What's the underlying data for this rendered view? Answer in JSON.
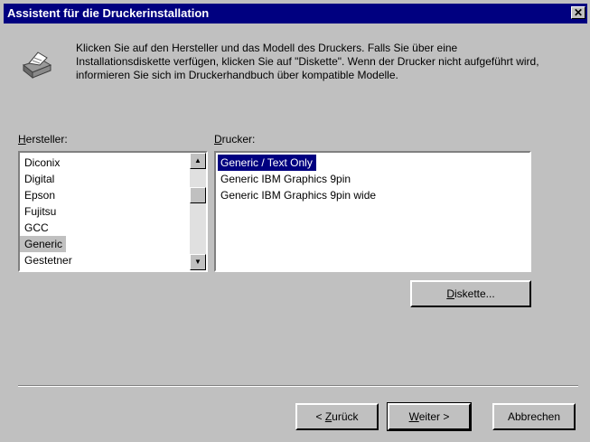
{
  "window": {
    "title": "Assistent für die Druckerinstallation",
    "close_glyph": "✕"
  },
  "intro": {
    "text": "Klicken Sie auf den Hersteller und das Modell des Druckers. Falls Sie über eine Installationsdiskette verfügen, klicken Sie auf \"Diskette\". Wenn der Drucker nicht aufgeführt wird, informieren Sie sich im Druckerhandbuch über kompatible Modelle."
  },
  "manufacturer": {
    "label_hotkey": "H",
    "label_rest": "ersteller:",
    "items": [
      "Diconix",
      "Digital",
      "Epson",
      "Fujitsu",
      "GCC",
      "Generic",
      "Gestetner"
    ],
    "selected": "Generic"
  },
  "printer": {
    "label_hotkey": "D",
    "label_rest": "rucker:",
    "items": [
      "Generic / Text Only",
      "Generic IBM Graphics 9pin",
      "Generic IBM Graphics 9pin wide"
    ],
    "selected": "Generic / Text Only"
  },
  "buttons": {
    "disk": {
      "hotkey": "D",
      "rest": "iskette..."
    },
    "back": {
      "prefix": "< ",
      "hotkey": "Z",
      "rest": "urück"
    },
    "next": {
      "hotkey": "W",
      "rest": "eiter >"
    },
    "cancel": "Abbrechen"
  },
  "icons": {
    "printer": "printer-icon",
    "scroll_up": "▲",
    "scroll_down": "▼"
  },
  "colors": {
    "titlebar": "#000080",
    "selection": "#000080",
    "face": "#c0c0c0"
  }
}
